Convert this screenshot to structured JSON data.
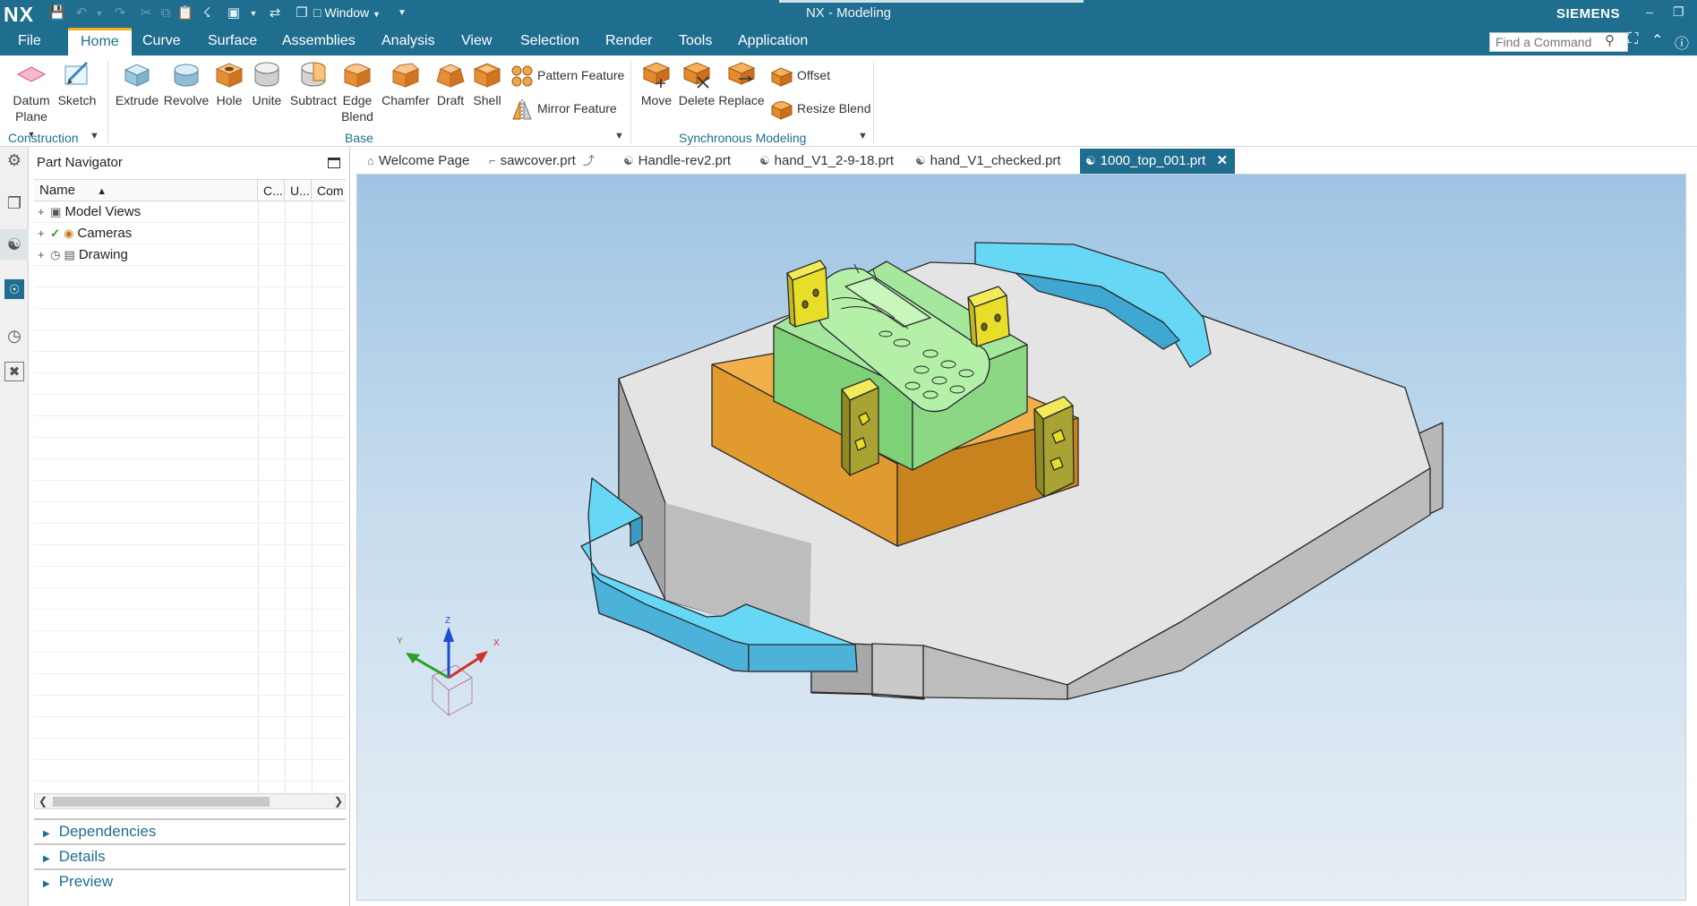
{
  "app": {
    "logo": "NX",
    "title": "NX - Modeling",
    "brand": "SIEMENS",
    "window_menu": "Window"
  },
  "menu": {
    "items": [
      "File",
      "Home",
      "Curve",
      "Surface",
      "Assemblies",
      "Analysis",
      "View",
      "Selection",
      "Render",
      "Tools",
      "Application"
    ],
    "active": "Home"
  },
  "search": {
    "placeholder": "Find a Command"
  },
  "ribbon": {
    "construction": {
      "label": "Construction",
      "datum_plane_line1": "Datum",
      "datum_plane_line2": "Plane",
      "sketch": "Sketch"
    },
    "base": {
      "label": "Base",
      "extrude": "Extrude",
      "revolve": "Revolve",
      "hole": "Hole",
      "unite": "Unite",
      "subtract": "Subtract",
      "edge_blend_line1": "Edge",
      "edge_blend_line2": "Blend",
      "chamfer": "Chamfer",
      "draft": "Draft",
      "shell": "Shell",
      "pattern_feature": "Pattern Feature",
      "mirror_feature": "Mirror Feature"
    },
    "sync": {
      "label": "Synchronous Modeling",
      "move": "Move",
      "delete": "Delete",
      "replace": "Replace",
      "offset": "Offset",
      "resize_blend": "Resize Blend"
    }
  },
  "navigator": {
    "title": "Part Navigator",
    "columns": [
      "Name",
      "C...",
      "U...",
      "Com"
    ],
    "nodes": [
      "Model Views",
      "Cameras",
      "Drawing"
    ],
    "sections": [
      "Dependencies",
      "Details",
      "Preview"
    ]
  },
  "tabs": [
    {
      "label": "Welcome Page"
    },
    {
      "label": "sawcover.prt"
    },
    {
      "label": "Handle-rev2.prt"
    },
    {
      "label": "hand_V1_2-9-18.prt"
    },
    {
      "label": "hand_V1_checked.prt"
    },
    {
      "label": "1000_top_001.prt"
    }
  ],
  "triad": {
    "x": "X",
    "y": "Y",
    "z": "Z"
  },
  "colors": {
    "titlebar": "#1f6e8f",
    "accent": "#f2b01e",
    "plate": "#e3e3e3",
    "handle": "#63d3f2",
    "mold_green": "#a6e79e",
    "base_orange": "#e8a63a",
    "clamp_yellow": "#e8de2a"
  }
}
